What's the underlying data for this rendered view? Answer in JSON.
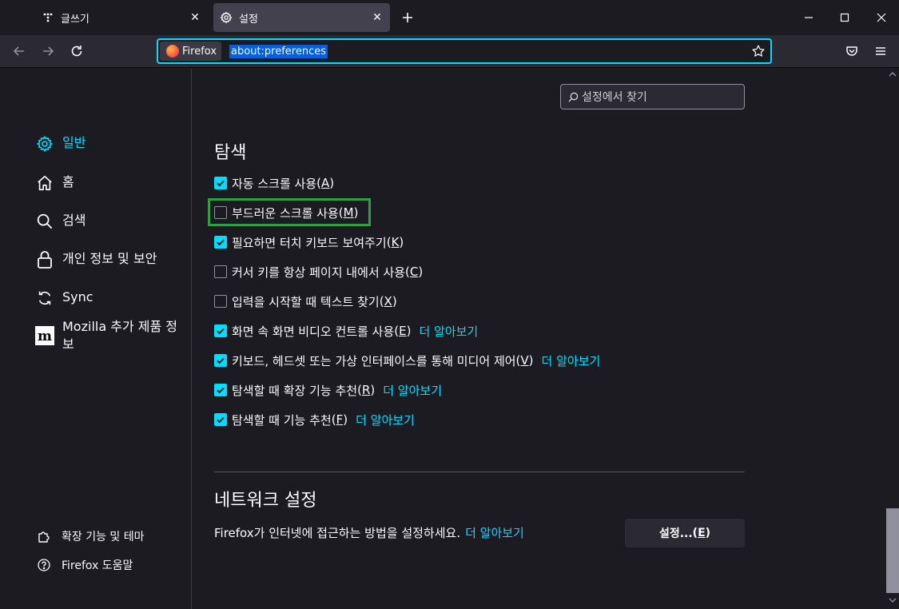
{
  "tabs": [
    {
      "label": "글쓰기",
      "icon": "writing-icon",
      "active": false
    },
    {
      "label": "설정",
      "icon": "gear-icon",
      "active": true
    }
  ],
  "urlbar": {
    "identity_label": "Firefox",
    "url": "about:preferences"
  },
  "sidebar": {
    "categories": [
      {
        "label": "일반",
        "icon": "gear-icon",
        "selected": true
      },
      {
        "label": "홈",
        "icon": "home-icon",
        "selected": false
      },
      {
        "label": "검색",
        "icon": "search-icon",
        "selected": false
      },
      {
        "label": "개인 정보 및 보안",
        "icon": "lock-icon",
        "selected": false
      },
      {
        "label": "Sync",
        "icon": "sync-icon",
        "selected": false
      },
      {
        "label_line1": "Mozilla 추가 제품 정",
        "label_line2": "보",
        "icon": "mozilla-icon",
        "selected": false
      }
    ],
    "footer": [
      {
        "label": "확장 기능 및 테마",
        "icon": "puzzle-icon"
      },
      {
        "label": "Firefox 도움말",
        "icon": "help-icon"
      }
    ]
  },
  "search": {
    "placeholder": "설정에서 찾기"
  },
  "browsing": {
    "heading": "탐색",
    "options": [
      {
        "label": "자동 스크롤 사용",
        "accesskey": "A",
        "checked": true
      },
      {
        "label": "부드러운 스크롤 사용",
        "accesskey": "M",
        "checked": false
      },
      {
        "label": "필요하면 터치 키보드 보여주기",
        "accesskey": "K",
        "checked": true
      },
      {
        "label": "커서 키를 항상 페이지 내에서 사용",
        "accesskey": "C",
        "checked": false
      },
      {
        "label": "입력을 시작할 때 텍스트 찾기",
        "accesskey": "X",
        "checked": false
      },
      {
        "label": "화면 속 화면 비디오 컨트롤 사용",
        "accesskey": "E",
        "checked": true,
        "link": "더 알아보기"
      },
      {
        "label": "키보드, 헤드셋 또는 가상 인터페이스를 통해 미디어 제어",
        "accesskey": "V",
        "checked": true,
        "link": "더 알아보기"
      },
      {
        "label": "탐색할 때 확장 기능 추천",
        "accesskey": "R",
        "checked": true,
        "link": "더 알아보기"
      },
      {
        "label": "탐색할 때 기능 추천",
        "accesskey": "F",
        "checked": true,
        "link": "더 알아보기"
      }
    ]
  },
  "network": {
    "heading": "네트워크 설정",
    "description": "Firefox가 인터넷에 접근하는 방법을 설정하세요.",
    "link": "더 알아보기",
    "button_label": "설정...",
    "button_accesskey": "E"
  },
  "colors": {
    "accent": "#00ddff",
    "background": "#1c1b22",
    "toolbar": "#2b2a33",
    "focus": "#2ea043"
  }
}
